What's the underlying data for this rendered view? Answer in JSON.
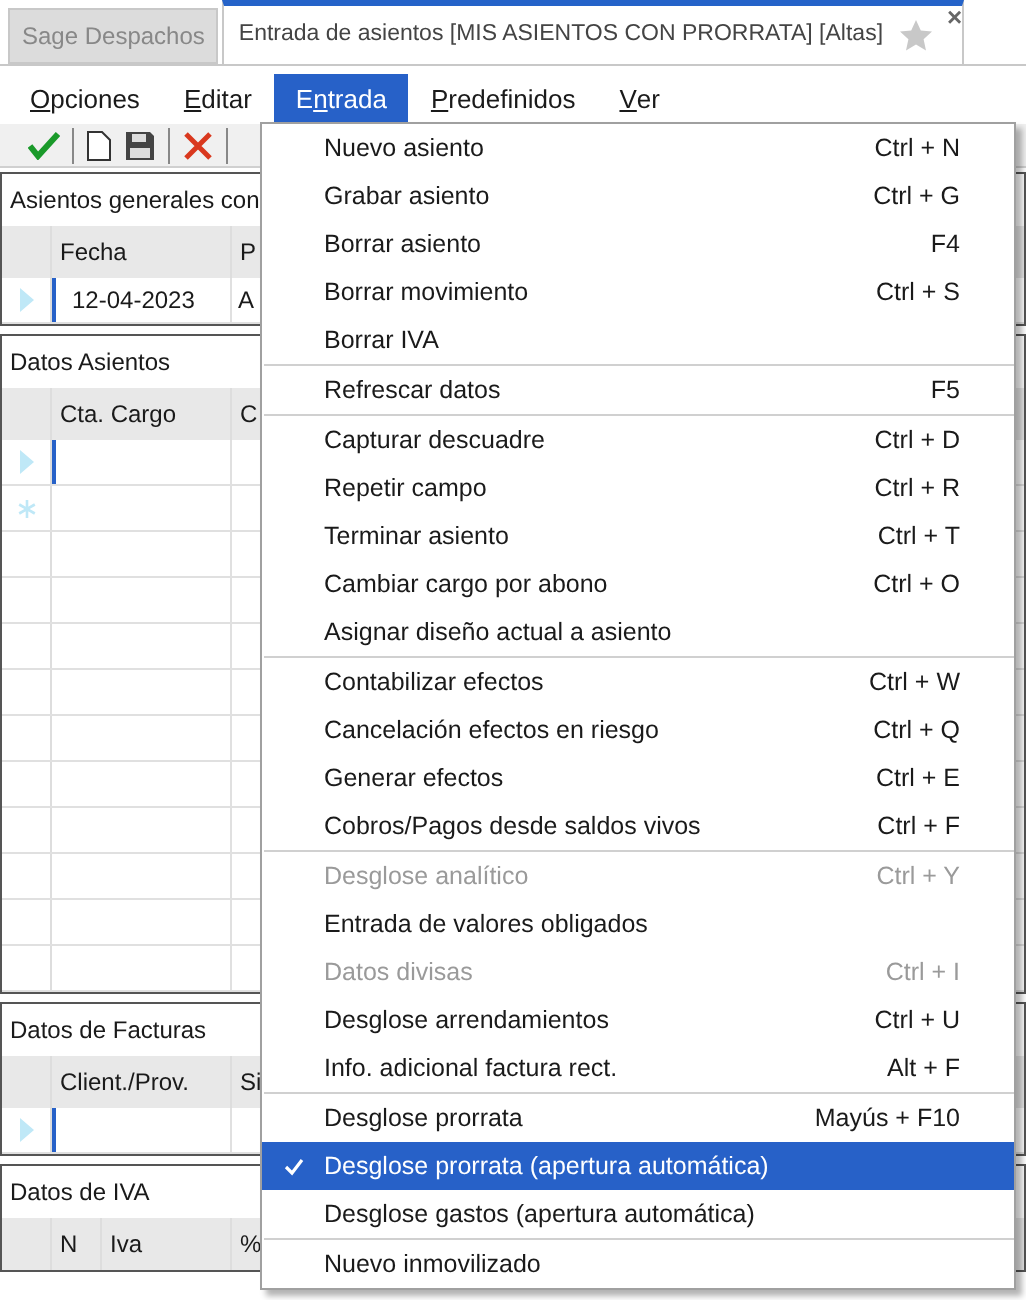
{
  "tabs": [
    {
      "label": "Sage Despachos",
      "selected": false
    },
    {
      "label": "Entrada de asientos [MIS ASIENTOS CON PRORRATA] [Altas]",
      "selected": true,
      "close": "×"
    }
  ],
  "menu_bar": [
    {
      "key": "O",
      "after": "pciones",
      "selected": false
    },
    {
      "key": "E",
      "after": "ditar",
      "selected": false
    },
    {
      "before": "E",
      "key": "n",
      "after": "trada",
      "selected": true
    },
    {
      "key": "P",
      "after": "redefinidos",
      "selected": false
    },
    {
      "key": "V",
      "after": "er",
      "selected": false
    }
  ],
  "panels": [
    {
      "title": "Asientos generales con",
      "columns": [
        "Fecha",
        "P"
      ],
      "rows": [
        {
          "cells": [
            "12-04-2023",
            "A"
          ],
          "kind": "current"
        }
      ]
    },
    {
      "title": "Datos Asientos",
      "columns": [
        "Cta. Cargo",
        "C"
      ],
      "rows": [
        {
          "cells": [
            "",
            ""
          ],
          "kind": "current"
        },
        {
          "cells": [
            "",
            ""
          ],
          "kind": "new"
        }
      ]
    },
    {
      "title": "Datos de Facturas",
      "columns": [
        "Client./Prov.",
        "Si"
      ],
      "rows": [
        {
          "cells": [
            "",
            ""
          ],
          "kind": "current"
        }
      ]
    },
    {
      "title": "Datos de IVA",
      "columns": [
        "N",
        "Iva",
        "%"
      ]
    }
  ],
  "dropdown": [
    [
      {
        "label": "Nuevo asiento",
        "shortcut": "Ctrl + N",
        "disabled": false,
        "checked": false,
        "selected": false
      },
      {
        "label": "Grabar asiento",
        "shortcut": "Ctrl + G",
        "disabled": false,
        "checked": false,
        "selected": false
      },
      {
        "label": "Borrar asiento",
        "shortcut": "F4",
        "disabled": false,
        "checked": false,
        "selected": false
      },
      {
        "label": "Borrar movimiento",
        "shortcut": "Ctrl + S",
        "disabled": false,
        "checked": false,
        "selected": false
      },
      {
        "label": "Borrar IVA",
        "disabled": false,
        "checked": false,
        "selected": false
      }
    ],
    [
      {
        "label": "Refrescar datos",
        "shortcut": "F5",
        "disabled": false,
        "checked": false,
        "selected": false
      }
    ],
    [
      {
        "label": "Capturar descuadre",
        "shortcut": "Ctrl + D",
        "disabled": false,
        "checked": false,
        "selected": false
      },
      {
        "label": "Repetir campo",
        "shortcut": "Ctrl + R",
        "disabled": false,
        "checked": false,
        "selected": false
      },
      {
        "label": "Terminar asiento",
        "shortcut": "Ctrl + T",
        "disabled": false,
        "checked": false,
        "selected": false
      },
      {
        "label": "Cambiar cargo por abono",
        "shortcut": "Ctrl + O",
        "disabled": false,
        "checked": false,
        "selected": false
      },
      {
        "label": "Asignar diseño actual a asiento",
        "disabled": false,
        "checked": false,
        "selected": false
      }
    ],
    [
      {
        "label": "Contabilizar efectos",
        "shortcut": "Ctrl + W",
        "disabled": false,
        "checked": false,
        "selected": false
      },
      {
        "label": "Cancelación efectos en riesgo",
        "shortcut": "Ctrl + Q",
        "disabled": false,
        "checked": false,
        "selected": false
      },
      {
        "label": "Generar efectos",
        "shortcut": "Ctrl + E",
        "disabled": false,
        "checked": false,
        "selected": false
      },
      {
        "label": "Cobros/Pagos desde saldos vivos",
        "shortcut": "Ctrl + F",
        "disabled": false,
        "checked": false,
        "selected": false
      }
    ],
    [
      {
        "label": "Desglose analítico",
        "shortcut": "Ctrl + Y",
        "disabled": true,
        "checked": false,
        "selected": false
      },
      {
        "label": "Entrada de valores obligados",
        "disabled": false,
        "checked": false,
        "selected": false
      },
      {
        "label": "Datos divisas",
        "shortcut": "Ctrl + I",
        "disabled": true,
        "checked": false,
        "selected": false
      },
      {
        "label": "Desglose arrendamientos",
        "shortcut": "Ctrl + U",
        "disabled": false,
        "checked": false,
        "selected": false
      },
      {
        "label": "Info. adicional factura rect.",
        "shortcut": "Alt + F",
        "disabled": false,
        "checked": false,
        "selected": false
      }
    ],
    [
      {
        "label": "Desglose prorrata",
        "shortcut": "Mayús + F10",
        "disabled": false,
        "checked": false,
        "selected": false
      },
      {
        "label": "Desglose prorrata (apertura automática)",
        "disabled": false,
        "checked": true,
        "selected": true
      },
      {
        "label": "Desglose gastos (apertura automática)",
        "disabled": false,
        "checked": false,
        "selected": false
      }
    ],
    [
      {
        "label": "Nuevo inmovilizado",
        "disabled": false,
        "checked": false,
        "selected": false
      }
    ]
  ]
}
